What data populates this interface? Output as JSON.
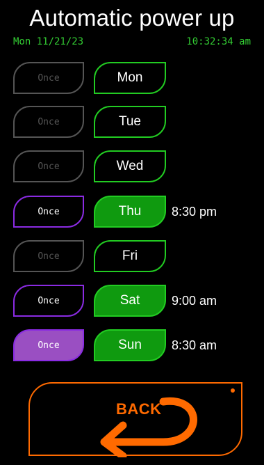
{
  "header": {
    "title": "Automatic power up",
    "date": "Mon 11/21/23",
    "time": "10:32:34 am"
  },
  "schedule": [
    {
      "once_label": "Once",
      "once_state": "off",
      "day": "Mon",
      "day_active": false,
      "time": ""
    },
    {
      "once_label": "Once",
      "once_state": "off",
      "day": "Tue",
      "day_active": false,
      "time": ""
    },
    {
      "once_label": "Once",
      "once_state": "off",
      "day": "Wed",
      "day_active": false,
      "time": ""
    },
    {
      "once_label": "Once",
      "once_state": "on",
      "day": "Thu",
      "day_active": true,
      "time": "8:30 pm"
    },
    {
      "once_label": "Once",
      "once_state": "off",
      "day": "Fri",
      "day_active": false,
      "time": ""
    },
    {
      "once_label": "Once",
      "once_state": "on",
      "day": "Sat",
      "day_active": true,
      "time": "9:00 am"
    },
    {
      "once_label": "Once",
      "once_state": "filled",
      "day": "Sun",
      "day_active": true,
      "time": "8:30 am"
    }
  ],
  "footer": {
    "back_label": "BACK",
    "back_icon": "u-turn-arrow-icon"
  },
  "colors": {
    "background": "#000000",
    "accent_green": "#22cc22",
    "active_green": "#0f9a0f",
    "accent_purple": "#8a2be2",
    "purple_fill": "#9a4fc2",
    "inactive_gray": "#555555",
    "back_orange": "#ff6a00"
  }
}
